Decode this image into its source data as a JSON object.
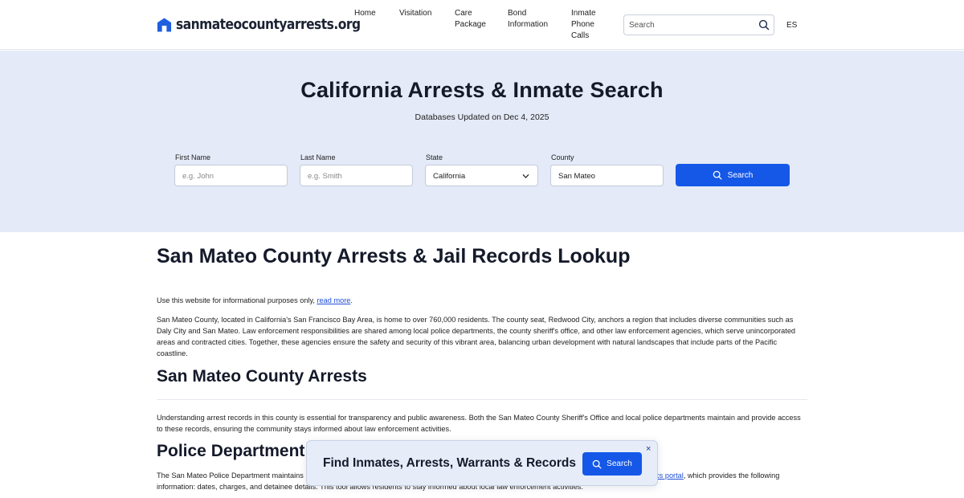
{
  "header": {
    "logo_text": "sanmateocountyarrests.org",
    "logo_icon": "house-icon",
    "nav": {
      "home": "Home",
      "visitation": "Visitation",
      "care_package": "Care Package",
      "bond_information": "Bond Information",
      "inmate_phone_calls": "Inmate Phone Calls"
    },
    "search_placeholder": "Search",
    "search_icon": "search-icon",
    "language": "ES"
  },
  "hero": {
    "title": "California Arrests & Inmate Search",
    "subtitle": "Databases Updated on Dec 4, 2025",
    "form": {
      "first_name_label": "First Name",
      "first_name_placeholder": "e.g. John",
      "last_name_label": "Last Name",
      "last_name_placeholder": "e.g. Smith",
      "state_label": "State",
      "state_value": "California",
      "county_label": "County",
      "county_value": "San Mateo",
      "search_button": "Search"
    }
  },
  "content": {
    "heading": "San Mateo County Arrests & Jail Records Lookup",
    "info_text": "Use this website for informational purposes only, ",
    "info_link": "read more",
    "info_end": ".",
    "county_paragraph": "San Mateo County, located in California's San Francisco Bay Area, is home to over 760,000 residents. The county seat, Redwood City, anchors a region that includes diverse communities such as Daly City and San Mateo. Law enforcement responsibilities are shared among local police departments, the county sheriff's office, and other law enforcement agencies, which serve unincorporated areas and contracted cities. Together, these agencies ensure the safety and security of this vibrant area, balancing urban development with natural landscapes that include parts of the Pacific coastline.",
    "arrests_heading": "San Mateo County Arrests",
    "arrests_paragraph": "Understanding arrest records in this county is essential for transparency and public awareness. Both the San Mateo County Sheriff's Office and local police departments maintain and provide access to these records, ensuring the community stays informed about law enforcement activities.",
    "police_heading": "Police Department Da",
    "police_text_start": "The San Mateo Police Department maintains",
    "police_link": "phics portal",
    "police_text_mid": ", which provides the following",
    "police_text_end": "information: dates, charges, and detainee details. This tool allows residents to stay informed about local law enforcement activities."
  },
  "popup": {
    "title": "Find Inmates, Arrests, Warrants & Records",
    "button": "Search",
    "close": "×"
  },
  "colors": {
    "accent": "#1558e8",
    "hero_bg": "#e4eaf7",
    "link": "#1f4fd6"
  }
}
